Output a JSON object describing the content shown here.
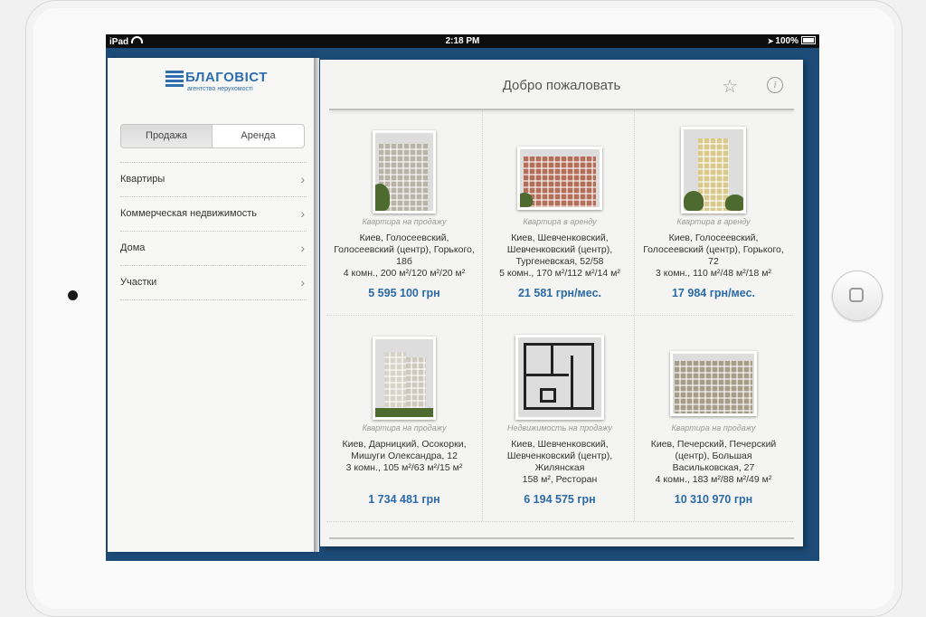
{
  "status_bar": {
    "device": "iPad",
    "time": "2:18 PM",
    "battery": "100%"
  },
  "sidebar": {
    "logo": {
      "title": "БЛАГОВІСТ",
      "subtitle": "агентство нерухомості"
    },
    "segments": [
      {
        "label": "Продажа",
        "selected": true
      },
      {
        "label": "Аренда",
        "selected": false
      }
    ],
    "menu": [
      {
        "label": "Квартиры"
      },
      {
        "label": "Коммерческая недвижимость"
      },
      {
        "label": "Дома"
      },
      {
        "label": "Участки"
      }
    ]
  },
  "header": {
    "title": "Добро пожаловать"
  },
  "listings": [
    {
      "type": "Квартира на продажу",
      "address": "Киев, Голосеевский, Голосеевский (центр), Горького, 18б",
      "details": "4 комн., 200 м²/120 м²/20 м²",
      "price": "5 595 100 грн"
    },
    {
      "type": "Квартира в аренду",
      "address": "Киев, Шевченковский, Шевченковский (центр), Тургеневская, 52/58",
      "details": "5 комн., 170 м²/112 м²/14 м²",
      "price": "21 581 грн/мес."
    },
    {
      "type": "Квартира в аренду",
      "address": "Киев, Голосеевский, Голосеевский (центр), Горького, 72",
      "details": "3 комн., 110 м²/48 м²/18 м²",
      "price": "17 984 грн/мес."
    },
    {
      "type": "Квартира на продажу",
      "address": "Киев, Дарницкий, Осокорки, Мишуги Олександра, 12",
      "details": "3 комн., 105 м²/63 м²/15 м²",
      "price": "1 734 481 грн"
    },
    {
      "type": "Недвижимость на продажу",
      "address": "Киев, Шевченковский, Шевченковский (центр), Жилянская",
      "details": "158 м², Ресторан",
      "price": "6 194 575 грн"
    },
    {
      "type": "Квартира на продажу",
      "address": "Киев, Печерский, Печерский (центр), Большая Васильковская, 27",
      "details": "4 комн., 183 м²/88 м²/49 м²",
      "price": "10 310 970 грн"
    }
  ],
  "icons": {
    "favorites": "star-icon",
    "info": "info-icon",
    "disclosure": "chevron-right-icon",
    "home": "home-button-icon"
  },
  "colors": {
    "accent": "#2b6aa6",
    "frame": "#1d4b78"
  }
}
